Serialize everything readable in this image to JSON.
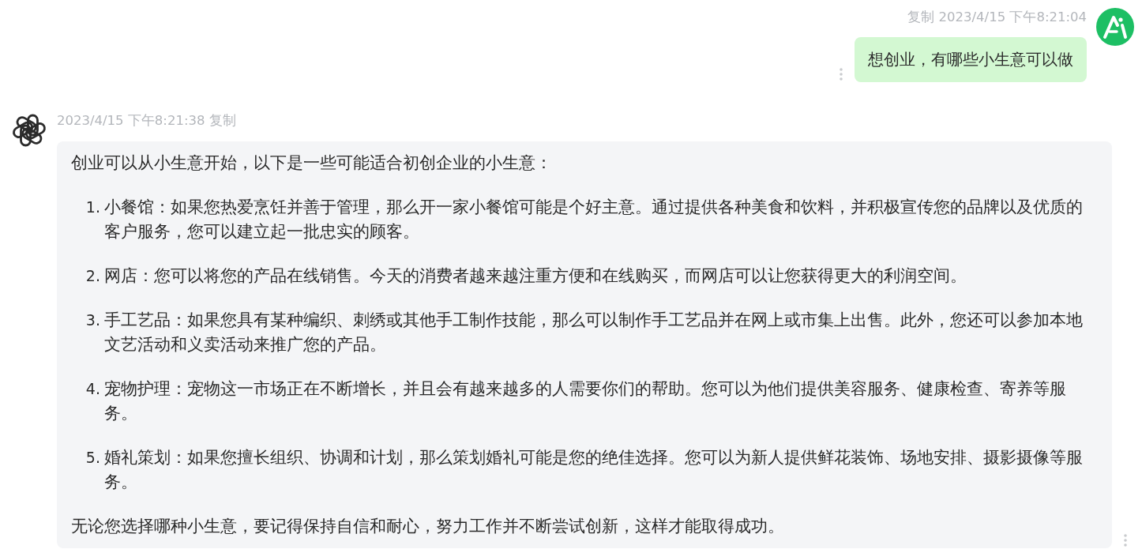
{
  "user_message": {
    "copy_label": "复制",
    "timestamp": "2023/4/15 下午8:21:04",
    "text": "想创业，有哪些小生意可以做"
  },
  "assistant_message": {
    "timestamp": "2023/4/15 下午8:21:38",
    "copy_label": "复制",
    "intro": "创业可以从小生意开始，以下是一些可能适合初创企业的小生意：",
    "items": [
      {
        "number": "1.",
        "text": "小餐馆：如果您热爱烹饪并善于管理，那么开一家小餐馆可能是个好主意。通过提供各种美食和饮料，并积极宣传您的品牌以及优质的客户服务，您可以建立起一批忠实的顾客。"
      },
      {
        "number": "2.",
        "text": "网店：您可以将您的产品在线销售。今天的消费者越来越注重方便和在线购买，而网店可以让您获得更大的利润空间。"
      },
      {
        "number": "3.",
        "text": "手工艺品：如果您具有某种编织、刺绣或其他手工制作技能，那么可以制作手工艺品并在网上或市集上出售。此外，您还可以参加本地文艺活动和义卖活动来推广您的产品。"
      },
      {
        "number": "4.",
        "text": "宠物护理：宠物这一市场正在不断增长，并且会有越来越多的人需要你们的帮助。您可以为他们提供美容服务、健康检查、寄养等服务。"
      },
      {
        "number": "5.",
        "text": "婚礼策划：如果您擅长组织、协调和计划，那么策划婚礼可能是您的绝佳选择。您可以为新人提供鲜花装饰、场地安排、摄影摄像等服务。"
      }
    ],
    "closing": "无论您选择哪种小生意，要记得保持自信和耐心，努力工作并不断尝试创新，这样才能取得成功。"
  }
}
